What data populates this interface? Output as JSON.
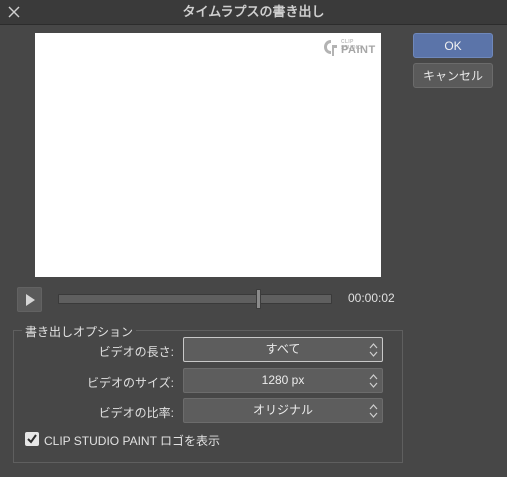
{
  "dialog": {
    "title": "タイムラプスの書き出し",
    "close_icon": "close-icon"
  },
  "preview": {
    "logo_small": "CLIP STUDIO",
    "logo_main": "PAINT"
  },
  "buttons": {
    "ok": "OK",
    "cancel": "キャンセル"
  },
  "playback": {
    "play_icon": "play-icon",
    "position_fraction": 0.73,
    "timecode": "00:00:02"
  },
  "options": {
    "group_title": "書き出しオプション",
    "video_length_label": "ビデオの長さ:",
    "video_length_value": "すべて",
    "video_size_label": "ビデオのサイズ:",
    "video_size_value": "1280 px",
    "video_ratio_label": "ビデオの比率:",
    "video_ratio_value": "オリジナル",
    "show_logo_checked": true,
    "show_logo_label": "CLIP STUDIO PAINT ロゴを表示"
  },
  "colors": {
    "background": "#474747",
    "accent": "#5b74a9"
  }
}
